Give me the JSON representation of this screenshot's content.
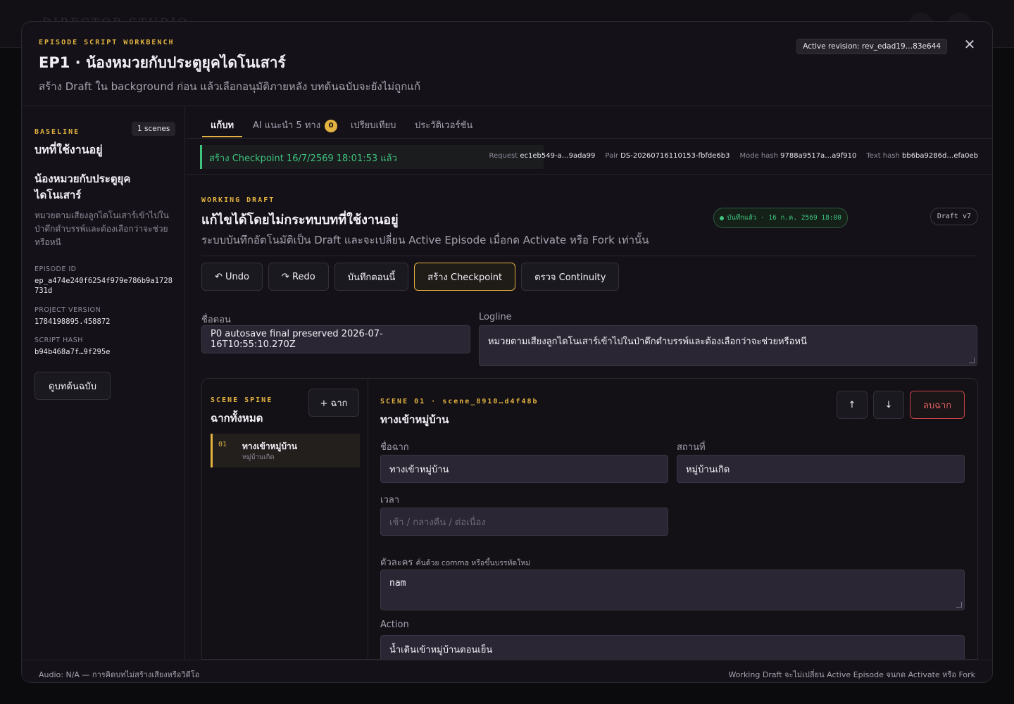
{
  "background": {
    "brand": "DIRECTOR STUDIO"
  },
  "header": {
    "eyebrow": "EPISODE SCRIPT WORKBENCH",
    "title": "EP1 · น้องหมวยกับประตูยุคไดโนเสาร์",
    "subtitle": "สร้าง Draft ใน background ก่อน แล้วเลือกอนุมัติภายหลัง บทต้นฉบับจะยังไม่ถูกแก้",
    "active_revision": "Active revision: rev_edad19…83e644",
    "close_icon": "close-icon"
  },
  "sidebar": {
    "eyebrow": "BASELINE",
    "scene_count": "1 scenes",
    "active_label": "บทที่ใช้งานอยู่",
    "episode_title": "น้องหมวยกับประตูยุคไดโนเสาร์",
    "logline": "หมวยตามเสียงลูกไดโนเสาร์เข้าไปในป่าดึกดำบรรพ์และต้องเลือกว่าจะช่วยหรือหนี",
    "meta": [
      {
        "label": "EPISODE ID",
        "value": "ep_a474e240f6254f979e786b9a1728731d"
      },
      {
        "label": "PROJECT VERSION",
        "value": "1784198895.458872"
      },
      {
        "label": "SCRIPT HASH",
        "value": "b94b468a7f…9f295e"
      }
    ],
    "view_baseline_label": "ดูบทต้นฉบับ"
  },
  "tabs": [
    {
      "label": "แก้บท",
      "active": true
    },
    {
      "label": "AI แนะนำ 5 ทาง",
      "badge": "0"
    },
    {
      "label": "เปรียบเทียบ"
    },
    {
      "label": "ประวัติเวอร์ชัน"
    }
  ],
  "infobar": {
    "checkpoint_message": "สร้าง Checkpoint 16/7/2569 18:01:53 แล้ว",
    "hashes": [
      {
        "label": "Request",
        "value": "ec1eb549-a…9ada99"
      },
      {
        "label": "Pair",
        "value": "DS-20260716110153-fbfde6b3"
      },
      {
        "label": "Mode hash",
        "value": "9788a9517a…a9f910"
      },
      {
        "label": "Text hash",
        "value": "bb6ba9286d…efa0eb"
      }
    ]
  },
  "working_draft": {
    "eyebrow": "WORKING DRAFT",
    "title": "แก้ไขได้โดยไม่กระทบบทที่ใช้งานอยู่",
    "subtitle": "ระบบบันทึกอัตโนมัติเป็น Draft และจะเปลี่ยน Active Episode เมื่อกด Activate หรือ Fork เท่านั้น",
    "saved_status": "บันทึกแล้ว · 16 ก.ค. 2569 18:00",
    "draft_version": "Draft v7"
  },
  "toolbar": {
    "undo": "↶ Undo",
    "redo": "↷ Redo",
    "save_now": "บันทึกตอนนี้",
    "create_checkpoint": "สร้าง Checkpoint",
    "check_continuity": "ตรวจ Continuity"
  },
  "episode_form": {
    "name_label": "ชื่อตอน",
    "name_value": "P0 autosave final preserved 2026-07-16T10:55:10.270Z",
    "logline_label": "Logline",
    "logline_value": "หมวยตามเสียงลูกไดโนเสาร์เข้าไปในป่าดึกดำบรรพ์และต้องเลือกว่าจะช่วยหรือหนี"
  },
  "scene_spine": {
    "eyebrow": "SCENE SPINE",
    "title": "ฉากทั้งหมด",
    "add_label": "+ ฉาก",
    "items": [
      {
        "num": "01",
        "name": "ทางเข้าหมู่บ้าน",
        "location": "หมู่บ้านเกิด"
      }
    ]
  },
  "scene_detail": {
    "eyebrow": "SCENE 01 · scene_8910…d4f48b",
    "title": "ทางเข้าหมู่บ้าน",
    "move_up": "↑",
    "move_down": "↓",
    "delete_label": "ลบฉาก",
    "scene_name_label": "ชื่อฉาก",
    "scene_name_value": "ทางเข้าหมู่บ้าน",
    "location_label": "สถานที่",
    "location_value": "หมู่บ้านเกิด",
    "time_label": "เวลา",
    "time_placeholder": "เช้า / กลางคืน / ต่อเนื่อง",
    "characters_label": "ตัวละคร",
    "characters_hint": "คั่นด้วย comma หรือขึ้นบรรทัดใหม่",
    "characters_value": "nam",
    "action_label": "Action",
    "action_value": "น้ำเดินเข้าหมู่บ้านตอนเย็น"
  },
  "footer": {
    "left": "Audio: N/A — การคิดบทไม่สร้างเสียงหรือวิดีโอ",
    "right": "Working Draft จะไม่เปลี่ยน Active Episode จนกด Activate หรือ Fork"
  },
  "colors": {
    "accent": "#e3b341",
    "success": "#3ec47f",
    "danger": "#e06060",
    "background": "#141218"
  }
}
